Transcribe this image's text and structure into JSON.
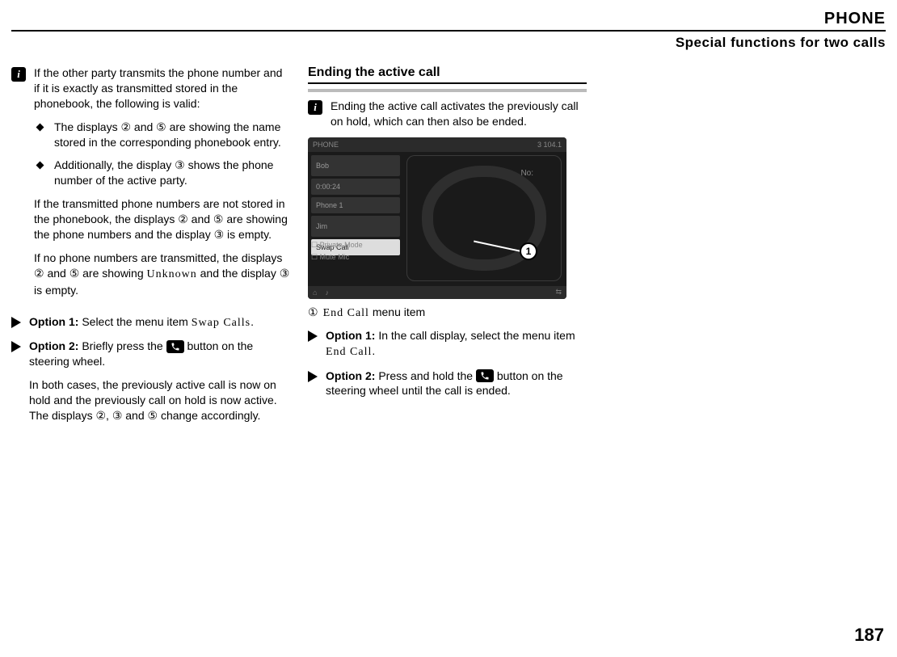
{
  "header": {
    "title": "PHONE",
    "subtitle": "Special functions for two calls"
  },
  "col1": {
    "info_intro": "If the other party transmits the phone number and if it is exactly as transmitted stored in the phonebook, the following is valid:",
    "bullets": [
      "The displays ② and ⑤ are showing the name stored in the corresponding phonebook entry.",
      "Additionally, the display ③ shows the phone number of the active party."
    ],
    "para_not_stored": "If the transmitted phone numbers are not stored in the phonebook, the displays ② and ⑤ are showing the phone numbers and the display ③ is empty.",
    "para_no_numbers_a": "If no phone numbers are transmitted, the displays ② and ⑤ are showing ",
    "unknown": "Unknown",
    "para_no_numbers_b": " and the display ③ is empty.",
    "opt1_a": "Option 1:",
    "opt1_b": " Select the menu item ",
    "swap": "Swap Calls",
    "opt1_c": ".",
    "opt2_a": "Option 2:",
    "opt2_b": " Briefly press the ",
    "opt2_c": " button on the steering wheel.",
    "both_cases": "In both cases, the previously active call is now on hold and the previously call on hold is now active. The displays ②, ③ and ⑤ change accordingly."
  },
  "col2": {
    "heading": "Ending the active call",
    "info": "Ending the active call activates the previously call on hold, which can then also be ended.",
    "mock": {
      "top_left": "PHONE",
      "top_right": "3   104.1",
      "sb1": "Bob",
      "sb2": "0:00:24",
      "sb3": "Phone 1",
      "sb4": "Jim",
      "sb5": "Swap Call",
      "chk1": "Private Mode",
      "chk2": "Mute Mic",
      "no": "No:",
      "callout": "1"
    },
    "legend_num": "①",
    "legend_a": "End Call",
    "legend_b": " menu item",
    "opt1_a": "Option 1:",
    "opt1_b": " In the call display, select the menu item ",
    "opt1_c": "End Call",
    "opt1_d": ".",
    "opt2_a": "Option 2:",
    "opt2_b": " Press and hold the ",
    "opt2_c": " button on the steering wheel until the call is ended."
  },
  "page": "187"
}
